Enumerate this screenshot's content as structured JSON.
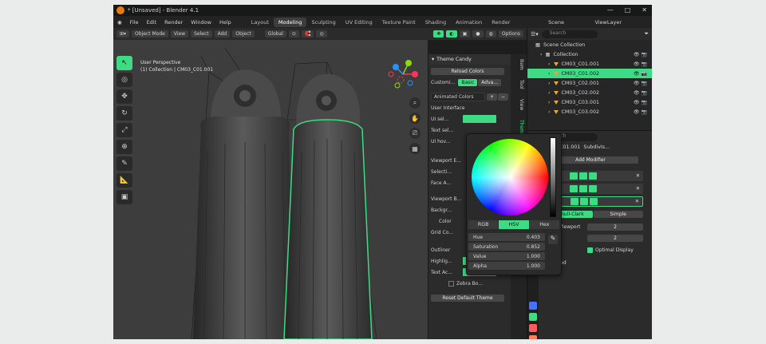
{
  "title_bar": {
    "title": "* [Unsaved] - Blender 4.1",
    "minimize": "—",
    "maximize": "□",
    "close": "✕"
  },
  "menu": [
    "File",
    "Edit",
    "Render",
    "Window",
    "Help"
  ],
  "workspaces": [
    "Layout",
    "Modeling",
    "Sculpting",
    "UV Editing",
    "Texture Paint",
    "Shading",
    "Animation",
    "Render"
  ],
  "active_workspace": "Modeling",
  "scene": "Scene",
  "view_layer": "ViewLayer",
  "header3d": {
    "mode": "Object Mode",
    "view": "View",
    "select": "Select",
    "add": "Add",
    "object": "Object",
    "transform": "Global",
    "options": "Options"
  },
  "viewport": {
    "view_name": "User Perspective",
    "collection": "(1) Collection | CM03_C01.001"
  },
  "npanel": {
    "title": "Theme Candy",
    "reload": "Reload Colors",
    "customize_label": "Customi...",
    "customize_basic": "Basic",
    "customize_adv": "Adva...",
    "preset": "Animated Colors",
    "section_user": "User Interface",
    "ui_sel": "UI sel...",
    "text_sel": "Text sel...",
    "ui_hov": "UI hov...",
    "section_vp": "Viewport E...",
    "selection": "Selecti...",
    "face_a": "Face A...",
    "section_vp2": "Viewport B...",
    "background": "Backgr...",
    "color": "Color",
    "grid": "Grid Co...",
    "section_out": "Outliner",
    "highlight": "Highlig...",
    "text_act": "Text Ac...",
    "zebra": "Zebra Bo...",
    "reset": "Reset Default Theme"
  },
  "ntabs": [
    "Item",
    "Tool",
    "View",
    "Theme"
  ],
  "outliner": {
    "search_placeholder": "Search",
    "rows": [
      {
        "label": "Scene Collection",
        "indent": 0,
        "selected": false
      },
      {
        "label": "Collection",
        "indent": 1,
        "selected": false
      },
      {
        "label": "CM03_C01.001",
        "indent": 2,
        "selected": false
      },
      {
        "label": "CM03_C01.002",
        "indent": 2,
        "selected": true
      },
      {
        "label": "CM03_C02.001",
        "indent": 2,
        "selected": false
      },
      {
        "label": "CM03_C02.002",
        "indent": 2,
        "selected": false
      },
      {
        "label": "CM03_C03.001",
        "indent": 2,
        "selected": false
      },
      {
        "label": "CM03_C03.002",
        "indent": 2,
        "selected": false
      }
    ]
  },
  "properties": {
    "search_placeholder": "Search",
    "object": "CM03_C01.001",
    "modifier_tab": "SubdivIs...",
    "add_modifier": "Add Modifier",
    "modifiers": [
      "Lat...",
      "Cur...",
      "Su..."
    ],
    "subdiv_modes": [
      "Catmull-Clark",
      "Simple"
    ],
    "levels_viewport_label": "Levels Viewport",
    "levels_viewport_value": "2",
    "render_label": "Render",
    "render_value": "2",
    "optimal_display": "Optimal Display",
    "advanced": "Advanced"
  },
  "color_picker": {
    "tabs": [
      "RGB",
      "HSV",
      "Hex"
    ],
    "active_tab": "HSV",
    "fields": [
      {
        "label": "Hue",
        "value": "0.403"
      },
      {
        "label": "Saturation",
        "value": "0.852"
      },
      {
        "label": "Value",
        "value": "1.000"
      },
      {
        "label": "Alpha",
        "value": "1.000"
      }
    ]
  },
  "colors": {
    "accent": "#3ddc84",
    "bg": "#1d1d1d",
    "panel": "#2b2b2b",
    "viewport": "#3d3d3d"
  },
  "icons": [
    "blender-logo",
    "cursor",
    "move",
    "rotate",
    "scale",
    "transform",
    "annotate",
    "measure",
    "add-cube",
    "zoom",
    "hand",
    "camera",
    "grid",
    "eyedropper",
    "eye",
    "camera-small"
  ]
}
